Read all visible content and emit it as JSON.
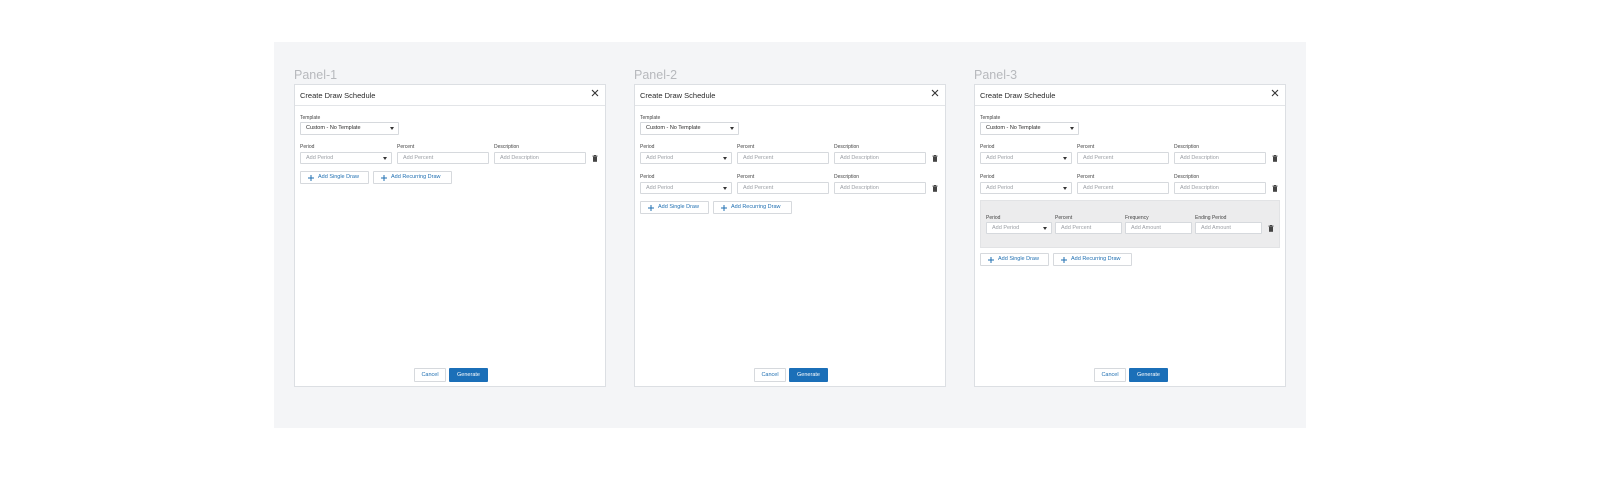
{
  "panels": [
    {
      "label": "Panel-1",
      "dialog": {
        "title": "Create Draw Schedule",
        "template_label": "Template",
        "template_value": "Custom - No Template",
        "rows": [
          {
            "period_label": "Period",
            "period_placeholder": "Add Period",
            "percent_label": "Percent",
            "percent_placeholder": "Add Percent",
            "description_label": "Description",
            "description_placeholder": "Add Description"
          }
        ],
        "add_single_label": "Add Single Draw",
        "add_recurring_label": "Add Recurring Draw",
        "cancel_label": "Cancel",
        "generate_label": "Generate"
      }
    },
    {
      "label": "Panel-2",
      "dialog": {
        "title": "Create Draw Schedule",
        "template_label": "Template",
        "template_value": "Custom - No Template",
        "rows": [
          {
            "period_label": "Period",
            "period_placeholder": "Add Period",
            "percent_label": "Percent",
            "percent_placeholder": "Add Percent",
            "description_label": "Description",
            "description_placeholder": "Add Description"
          },
          {
            "period_label": "Period",
            "period_placeholder": "Add Period",
            "percent_label": "Percent",
            "percent_placeholder": "Add Percent",
            "description_label": "Description",
            "description_placeholder": "Add Description"
          }
        ],
        "add_single_label": "Add Single Draw",
        "add_recurring_label": "Add Recurring Draw",
        "cancel_label": "Cancel",
        "generate_label": "Generate"
      }
    },
    {
      "label": "Panel-3",
      "dialog": {
        "title": "Create Draw Schedule",
        "template_label": "Template",
        "template_value": "Custom - No Template",
        "rows": [
          {
            "period_label": "Period",
            "period_placeholder": "Add Period",
            "percent_label": "Percent",
            "percent_placeholder": "Add Percent",
            "description_label": "Description",
            "description_placeholder": "Add Description"
          },
          {
            "period_label": "Period",
            "period_placeholder": "Add Period",
            "percent_label": "Percent",
            "percent_placeholder": "Add Percent",
            "description_label": "Description",
            "description_placeholder": "Add Description"
          }
        ],
        "recurring": {
          "period_label": "Period",
          "period_placeholder": "Add Period",
          "percent_label": "Percent",
          "percent_placeholder": "Add Percent",
          "frequency_label": "Frequency",
          "frequency_placeholder": "Add Amount",
          "ending_label": "Ending Period",
          "ending_placeholder": "Add Amount"
        },
        "add_single_label": "Add Single Draw",
        "add_recurring_label": "Add Recurring Draw",
        "cancel_label": "Cancel",
        "generate_label": "Generate"
      }
    }
  ],
  "colors": {
    "accent": "#1b6fb8",
    "link": "#1f6fb2",
    "board_bg": "#f4f5f7",
    "recurring_bg": "#ececed"
  },
  "icons": {
    "close": "close-icon",
    "caret": "chevron-down-icon",
    "trash": "trash-icon",
    "plus": "plus-icon"
  }
}
